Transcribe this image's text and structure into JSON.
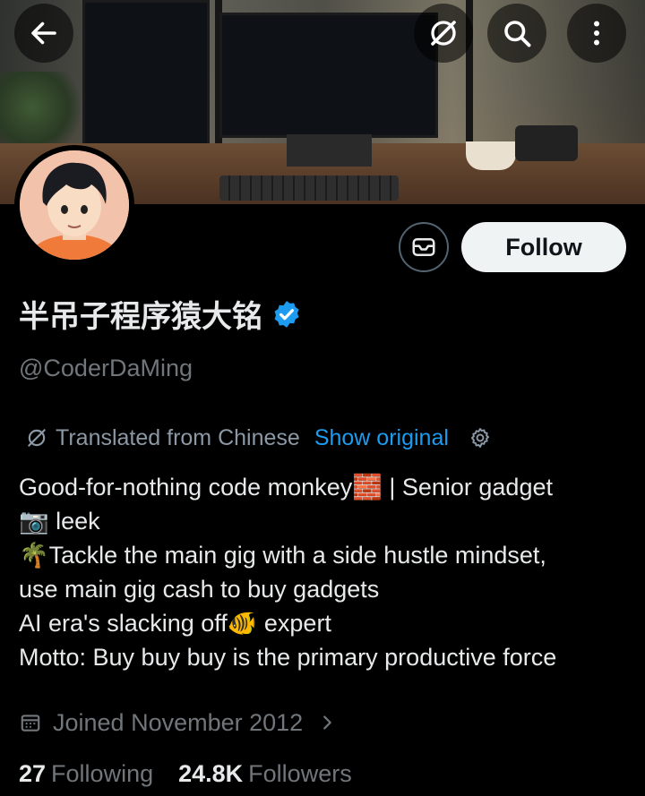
{
  "header": {
    "back_icon": "arrow-left-icon",
    "grok_icon": "slash-circle-icon",
    "search_icon": "search-icon",
    "more_icon": "more-vertical-icon"
  },
  "profile": {
    "display_name": "半吊子程序猿大铭",
    "verified": true,
    "handle": "@CoderDaMing",
    "follow_label": "Follow",
    "message_icon": "mail-icon"
  },
  "translation": {
    "text": "Translated from Chinese",
    "link": "Show original",
    "settings_icon": "gear-icon"
  },
  "bio": {
    "line1": "Good-for-nothing code monkey🧱 | Senior gadget",
    "line2": "📷 leek",
    "line3": "🌴Tackle the main gig with a side hustle mindset,",
    "line4": "use main gig cash to buy gadgets",
    "line5": "AI era's slacking off🐠 expert",
    "line6": "Motto: Buy buy buy is the primary productive force"
  },
  "joined": {
    "text": "Joined November 2012",
    "icon": "calendar-icon"
  },
  "stats": {
    "following_count": "27",
    "following_label": "Following",
    "followers_count": "24.8K",
    "followers_label": "Followers"
  },
  "colors": {
    "background": "#000000",
    "accent": "#1d9bf0",
    "secondary_text": "#71767b",
    "follow_button_bg": "#eff3f4"
  }
}
